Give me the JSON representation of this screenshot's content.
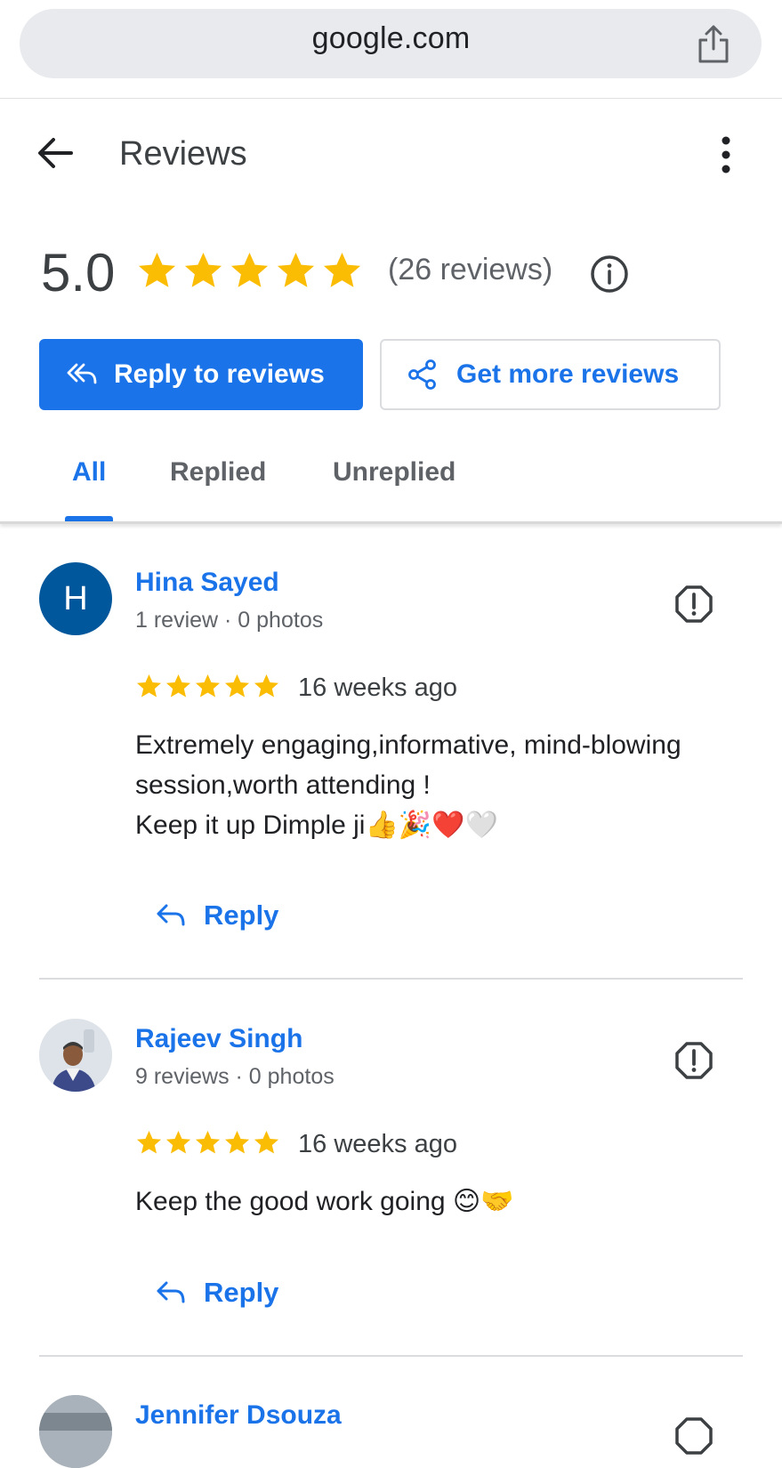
{
  "browser": {
    "url": "google.com",
    "share_icon": "share-icon"
  },
  "header": {
    "title": "Reviews",
    "back_icon": "arrow-back-icon",
    "menu_icon": "more-vert-icon"
  },
  "summary": {
    "rating": "5.0",
    "stars": 5,
    "count_label": "(26 reviews)",
    "star_color": "#fbbc04"
  },
  "actions": {
    "reply_label": "Reply to reviews",
    "get_more_label": "Get more reviews",
    "accent": "#1a73e8"
  },
  "tabs": [
    {
      "label": "All",
      "active": true
    },
    {
      "label": "Replied",
      "active": false
    },
    {
      "label": "Unreplied",
      "active": false
    }
  ],
  "reviews": [
    {
      "name": "Hina Sayed",
      "avatar_letter": "H",
      "meta": "1 review · 0 photos",
      "stars": 5,
      "ago": "16 weeks ago",
      "text": "Extremely engaging,informative, mind-blowing\nsession,worth attending !\nKeep it up Dimple ji👍🎉❤️🤍",
      "reply_label": "Reply"
    },
    {
      "name": "Rajeev Singh",
      "avatar_letter": "",
      "meta": "9 reviews · 0 photos",
      "stars": 5,
      "ago": "16 weeks ago",
      "text": "Keep the good work going 😊🤝",
      "reply_label": "Reply"
    },
    {
      "name": "Jennifer Dsouza"
    }
  ]
}
